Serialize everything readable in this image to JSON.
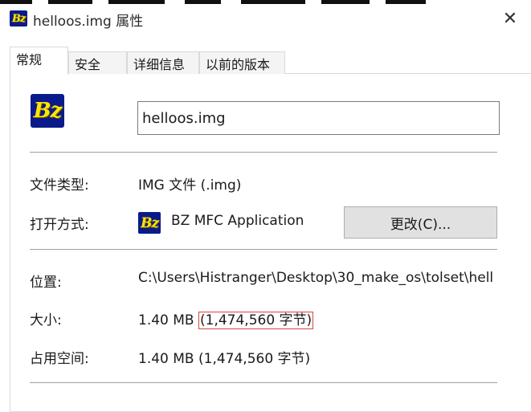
{
  "window": {
    "title": "helloos.img 属性",
    "close_glyph": "✕"
  },
  "tabs": [
    {
      "label": "常规",
      "active": true
    },
    {
      "label": "安全",
      "active": false
    },
    {
      "label": "详细信息",
      "active": false
    },
    {
      "label": "以前的版本",
      "active": false
    }
  ],
  "icon": {
    "text": "Bz",
    "bg_color": "#0a1a8a",
    "fg_color": "#ffe600"
  },
  "general": {
    "filename": "helloos.img",
    "file_type_label": "文件类型:",
    "file_type_value": "IMG 文件 (.img)",
    "open_with_label": "打开方式:",
    "open_with_value": "BZ MFC Application",
    "change_button": "更改(C)...",
    "location_label": "位置:",
    "location_value": "C:\\Users\\Histranger\\Desktop\\30_make_os\\tolset\\hell",
    "size_label": "大小:",
    "size_value": "1.40 MB",
    "size_bytes": "(1,474,560 字节)",
    "size_on_disk_label": "占用空间:",
    "size_on_disk_value": "1.40 MB (1,474,560 字节)"
  }
}
